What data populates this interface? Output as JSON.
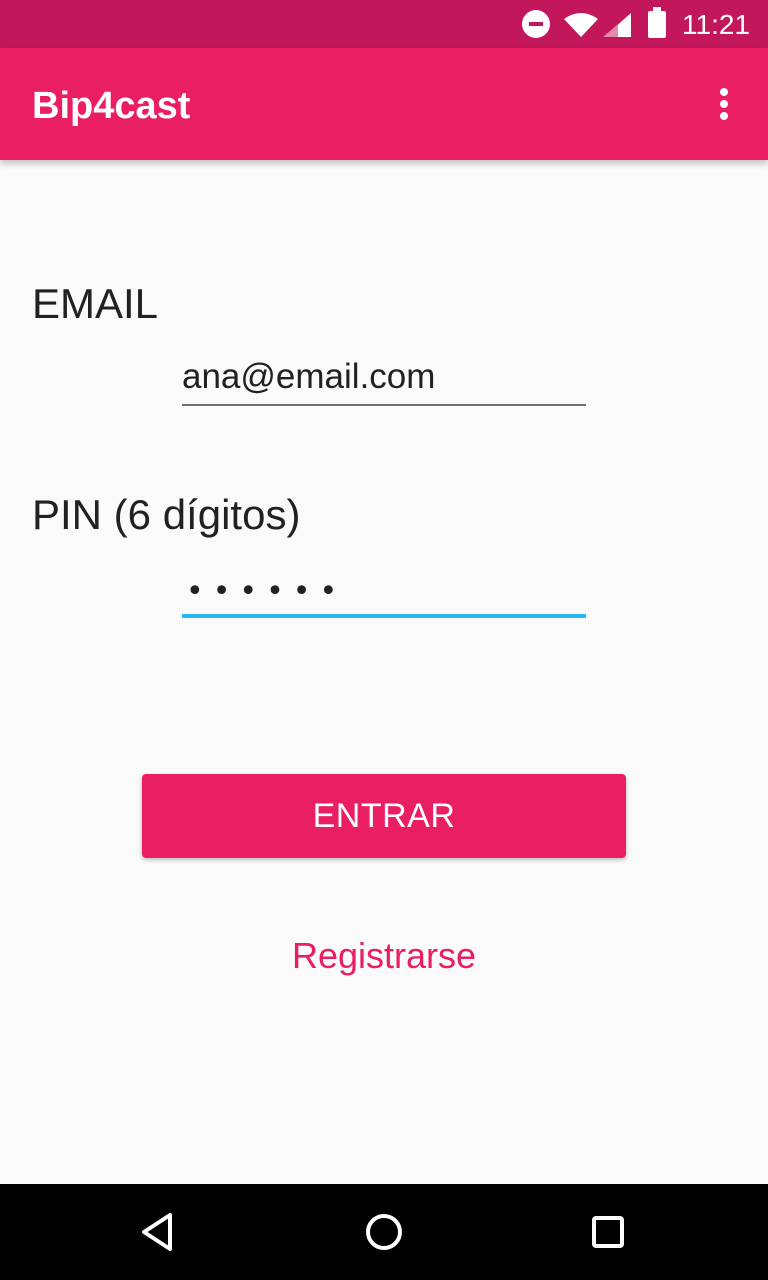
{
  "status_bar": {
    "time": "11:21",
    "icons": [
      "do-not-disturb-icon",
      "wifi-icon",
      "cell-signal-icon",
      "battery-icon"
    ]
  },
  "app_bar": {
    "title": "Bip4cast",
    "overflow_icon": "more-vert-icon"
  },
  "form": {
    "email_label": "EMAIL",
    "email_value": "ana@email.com",
    "pin_label": "PIN (6 dígitos)",
    "pin_value": "••••••"
  },
  "actions": {
    "login_label": "ENTRAR",
    "register_label": "Registrarse"
  },
  "nav_bar": {
    "icons": [
      "back-icon",
      "home-icon",
      "recents-icon"
    ]
  },
  "colors": {
    "primary": "#e91e63",
    "primary_dark": "#c2185b",
    "focus_underline": "#29b6f6",
    "background": "#fafafa"
  }
}
